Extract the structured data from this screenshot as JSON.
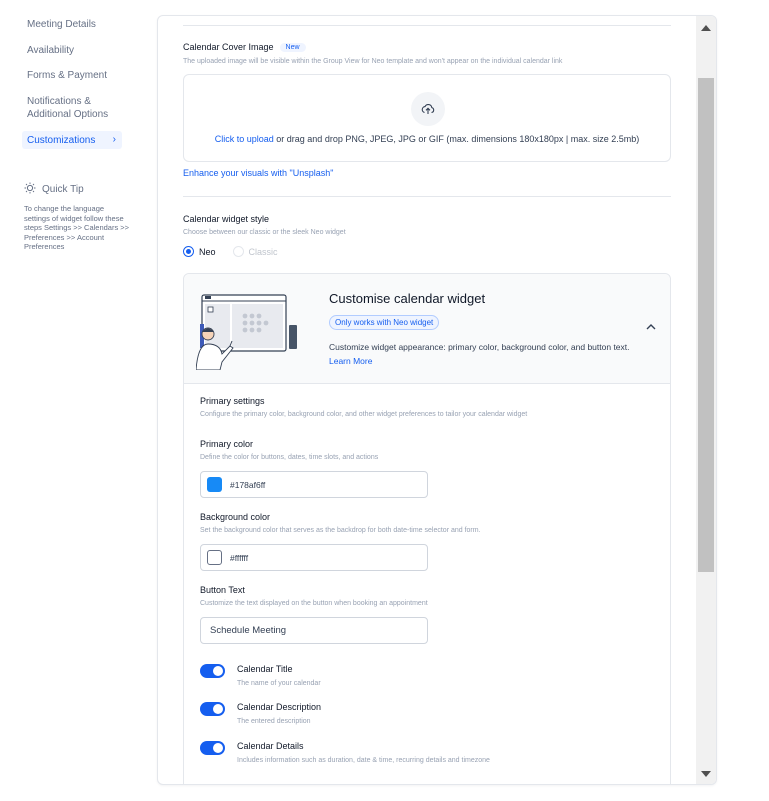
{
  "sidebar": {
    "items": [
      {
        "label": "Meeting Details"
      },
      {
        "label": "Availability"
      },
      {
        "label": "Forms & Payment"
      },
      {
        "label": "Notifications & Additional Options"
      },
      {
        "label": "Customizations",
        "chevron": "›"
      }
    ],
    "tip": {
      "title": "Quick Tip",
      "body": "To change the language settings of widget follow these steps Settings >> Calendars >> Preferences >> Account Preferences"
    }
  },
  "cover": {
    "title": "Calendar Cover Image",
    "badge": "New",
    "description": "The uploaded image will be visible within the Group View for Neo template and won't appear on the individual calendar link",
    "upload_link": "Click to upload",
    "upload_rest": " or drag and drop PNG, JPEG, JPG or GIF (max. dimensions 180x180px | max. size 2.5mb)",
    "unsplash": "Enhance your visuals with \"Unsplash\""
  },
  "style": {
    "title": "Calendar widget style",
    "description": "Choose between our classic or the sleek Neo widget",
    "options": [
      {
        "label": "Neo",
        "selected": true
      },
      {
        "label": "Classic",
        "selected": false
      }
    ]
  },
  "widget": {
    "title": "Customise calendar widget",
    "badge": "Only works with Neo widget",
    "description": "Customize widget appearance: primary color, background color, and button text.",
    "learn_more": "Learn More",
    "chevron": "⌃",
    "primary_settings": {
      "title": "Primary settings",
      "description": "Configure the primary color, background color, and other widget preferences to tailor your calendar widget"
    },
    "primary_color": {
      "label": "Primary color",
      "description": "Define the color for buttons, dates, time slots, and actions",
      "value": "#178af6ff",
      "swatch": "#178af6"
    },
    "background_color": {
      "label": "Background color",
      "description": "Set the background color that serves as the backdrop for both date-time selector and form.",
      "value": "#ffffff",
      "swatch": "#ffffff"
    },
    "button_text": {
      "label": "Button Text",
      "description": "Customize the text displayed on the button when booking an appointment",
      "value": "Schedule Meeting"
    },
    "toggles": [
      {
        "label": "Calendar Title",
        "description": "The name of your calendar",
        "on": true
      },
      {
        "label": "Calendar Description",
        "description": "The entered description",
        "on": true
      },
      {
        "label": "Calendar Details",
        "description": "Includes information such as duration, date & time, recurring details and timezone",
        "on": true
      }
    ]
  },
  "colors": {
    "accent": "#155eef",
    "primary_swatch": "#178af6"
  }
}
